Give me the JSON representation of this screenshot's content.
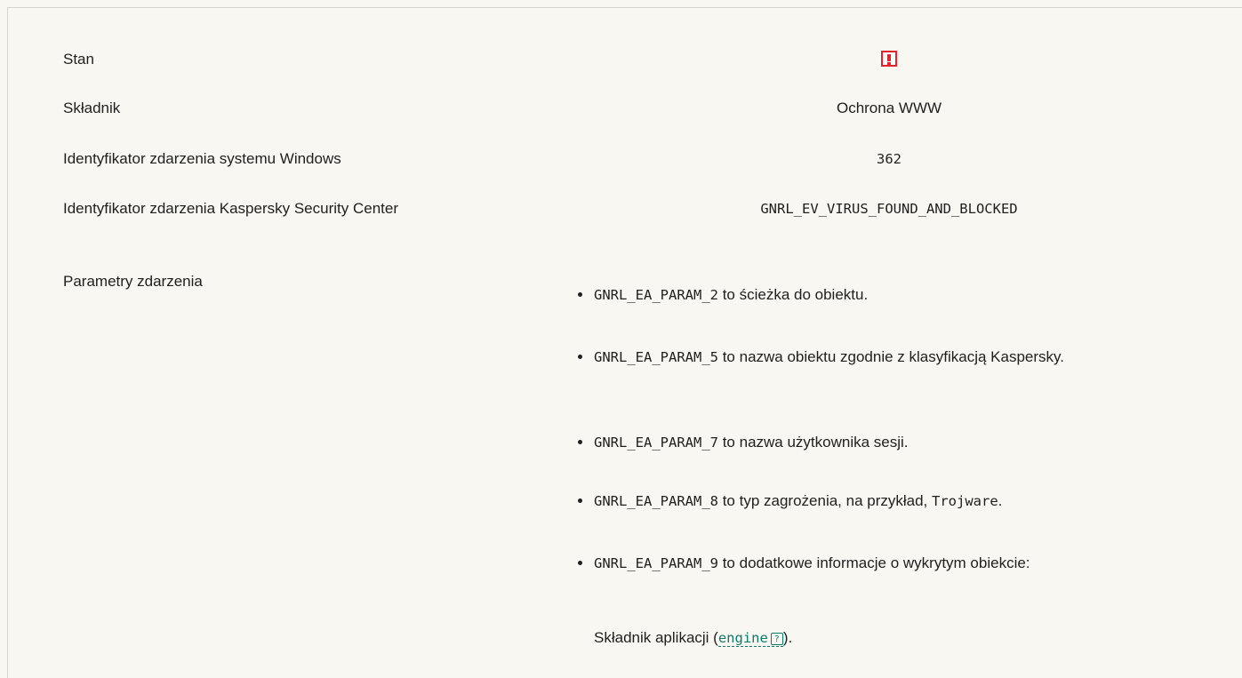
{
  "rows": {
    "status": {
      "label": "Stan",
      "icon": "warning-exclamation-icon",
      "icon_color": "#e0262c"
    },
    "component": {
      "label": "Składnik",
      "value": "Ochrona WWW"
    },
    "windows_event_id": {
      "label": "Identyfikator zdarzenia systemu Windows",
      "value": "362"
    },
    "ksc_event_id": {
      "label": "Identyfikator zdarzenia Kaspersky Security Center",
      "value": "GNRL_EV_VIRUS_FOUND_AND_BLOCKED"
    },
    "event_params": {
      "label": "Parametry zdarzenia"
    }
  },
  "params": [
    {
      "code": "GNRL_EA_PARAM_2",
      "text": " to ścieżka do obiektu."
    },
    {
      "code": "GNRL_EA_PARAM_5",
      "text": " to nazwa obiektu zgodnie z klasyfikacją Kaspersky."
    },
    {
      "code": "GNRL_EA_PARAM_7",
      "text": " to nazwa użytkownika sesji."
    },
    {
      "code": "GNRL_EA_PARAM_8",
      "text": " to typ zagrożenia, na przykład, ",
      "extra_code": "Trojware",
      "extra_suffix": "."
    },
    {
      "code": "GNRL_EA_PARAM_9",
      "text": " to dodatkowe informacje o wykrytym obiekcie:"
    }
  ],
  "note": {
    "prefix": "Składnik aplikacji (",
    "link": "engine",
    "help_icon": "help-question-icon",
    "help_glyph": "?",
    "suffix": ")."
  },
  "colors": {
    "accent": "#0f7c6a",
    "alert": "#e0262c",
    "background": "#f8f7f2"
  }
}
